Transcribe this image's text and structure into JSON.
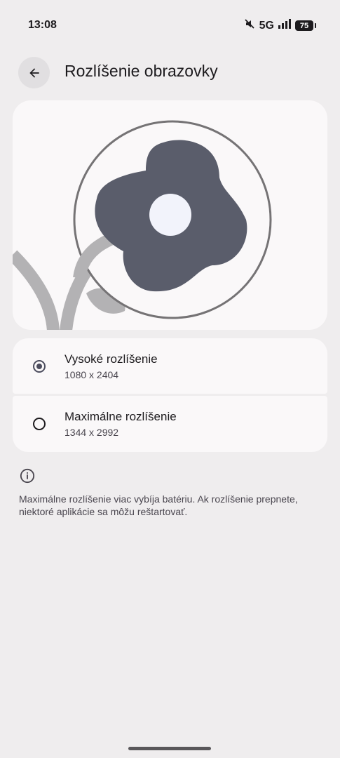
{
  "status_bar": {
    "time": "13:08",
    "network": "5G",
    "battery": "75",
    "icons": [
      "mute-icon",
      "signal-icon",
      "battery-icon"
    ]
  },
  "header": {
    "back_icon": "arrow-back-icon",
    "title": "Rozlíšenie obrazovky"
  },
  "illustration": {
    "icon": "flower-magnifier-illustration"
  },
  "options": [
    {
      "title": "Vysoké rozlíšenie",
      "subtitle": "1080 x 2404",
      "selected": true
    },
    {
      "title": "Maximálne rozlíšenie",
      "subtitle": "1344 x 2992",
      "selected": false
    }
  ],
  "info": {
    "icon": "info-icon",
    "text": "Maximálne rozlíšenie viac vybíja batériu. Ak rozlíšenie prepnete, niektoré aplikácie sa môžu reštartovať."
  },
  "colors": {
    "background": "#efedee",
    "card": "#faf8f9",
    "accent": "#4c4d5e",
    "flower": "#5a5d6b",
    "stem": "#b3b2b4"
  }
}
